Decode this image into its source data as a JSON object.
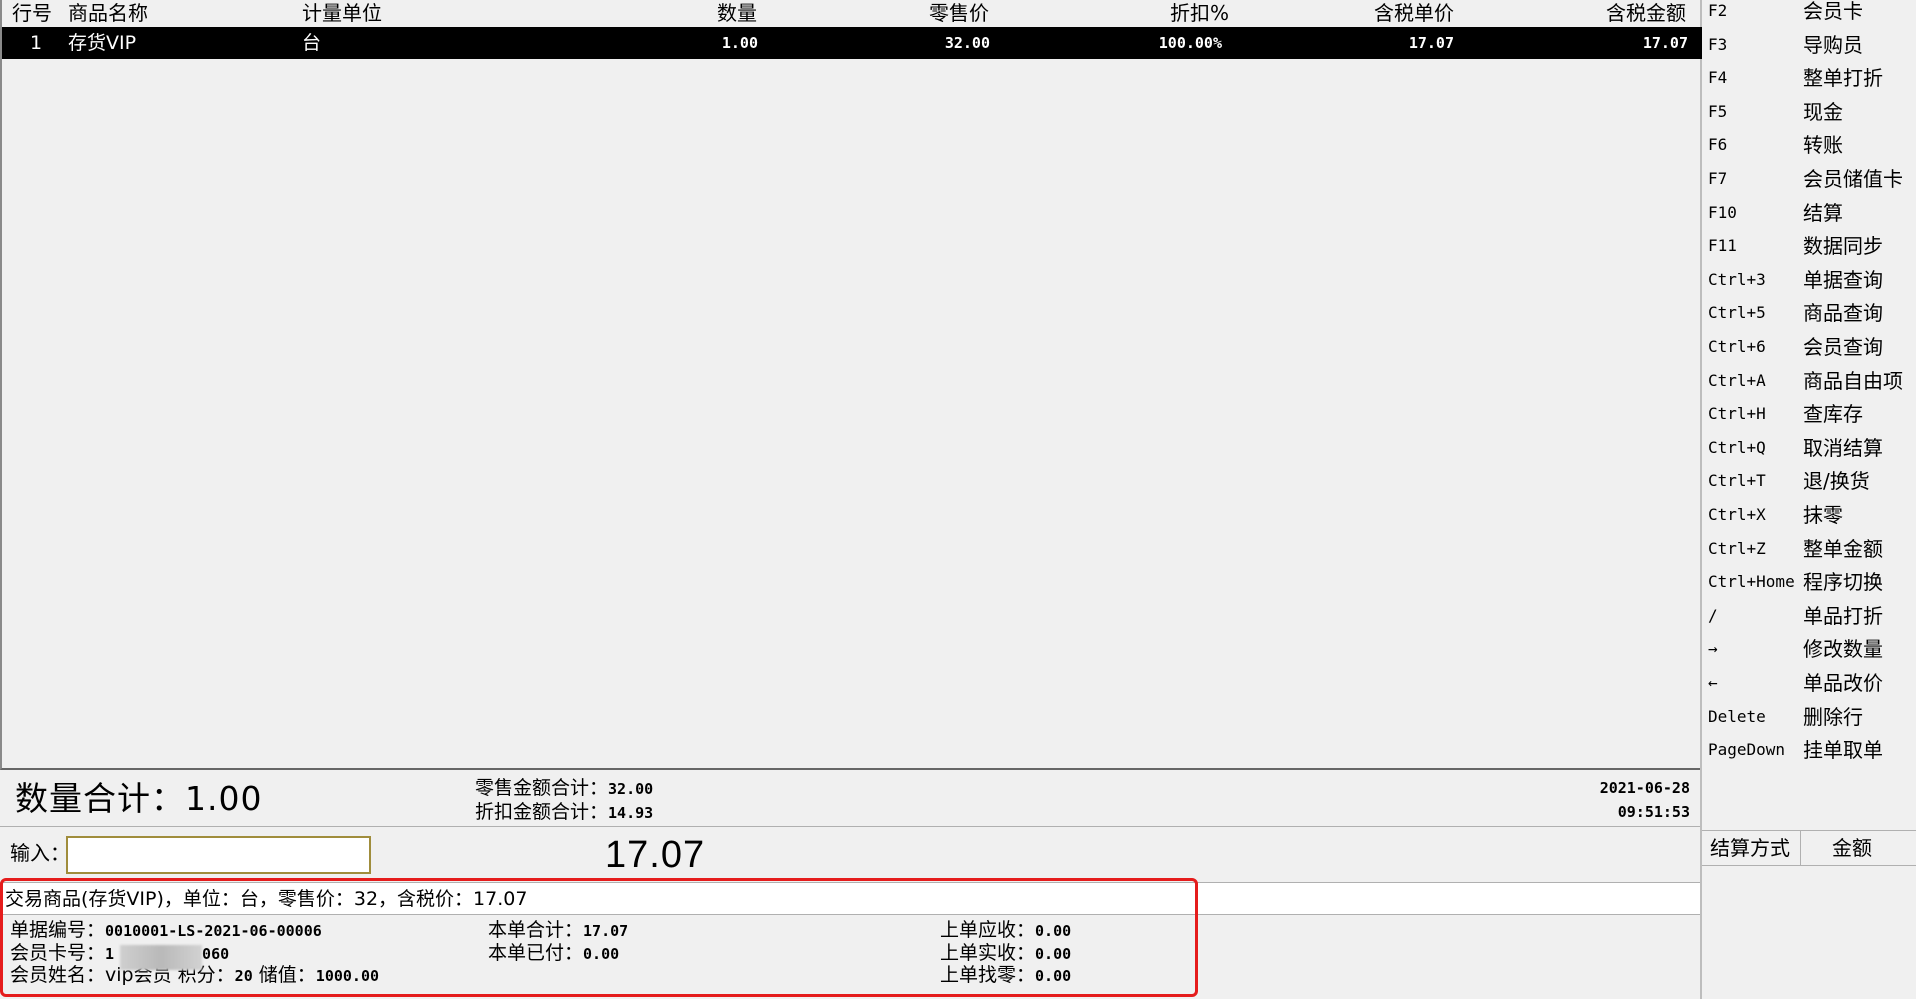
{
  "grid": {
    "headers": [
      "行号",
      "商品名称",
      "计量单位",
      "数量",
      "零售价",
      "折扣%",
      "含税单价",
      "含税金额"
    ],
    "row": {
      "line": "1",
      "name": "存货VIP",
      "unit": "台",
      "qty": "1.00",
      "retail": "32.00",
      "discount": "100.00%",
      "unit_price": "17.07",
      "amount": "17.07"
    }
  },
  "totals": {
    "qty_label": "数量合计：",
    "qty_value": "1.00",
    "retail_label": "零售金额合计：",
    "retail_value": "32.00",
    "discount_label": "折扣金额合计：",
    "discount_value": "14.93",
    "date": "2021-06-28",
    "time": "09:51:53"
  },
  "input": {
    "label": "输入：",
    "value": "",
    "big_amount": "17.07"
  },
  "info_line": "交易商品(存货VIP)，单位：台，零售价：32，含税价：17.07",
  "footer": {
    "doc_no_label": "单据编号：",
    "doc_no": "0010001-LS-2021-06-00006",
    "card_label": "会员卡号：",
    "card_start": "1",
    "card_end": "060",
    "member_name_label": "会员姓名：",
    "member_name": "vip会员",
    "points_label": "积分：",
    "points": "20",
    "stored_label": "储值：",
    "stored": "1000.00",
    "total_label": "本单合计：",
    "total": "17.07",
    "paid_label": "本单已付：",
    "paid": "0.00",
    "prev_due_label": "上单应收：",
    "prev_due": "0.00",
    "prev_recv_label": "上单实收：",
    "prev_recv": "0.00",
    "prev_change_label": "上单找零：",
    "prev_change": "0.00"
  },
  "shortcuts": [
    {
      "key": "F2",
      "action": "会员卡"
    },
    {
      "key": "F3",
      "action": "导购员"
    },
    {
      "key": "F4",
      "action": "整单打折"
    },
    {
      "key": "F5",
      "action": "现金"
    },
    {
      "key": "F6",
      "action": "转账"
    },
    {
      "key": "F7",
      "action": "会员储值卡"
    },
    {
      "key": "F10",
      "action": "结算"
    },
    {
      "key": "F11",
      "action": "数据同步"
    },
    {
      "key": "Ctrl+3",
      "action": "单据查询"
    },
    {
      "key": "Ctrl+5",
      "action": "商品查询"
    },
    {
      "key": "Ctrl+6",
      "action": "会员查询"
    },
    {
      "key": "Ctrl+A",
      "action": "商品自由项"
    },
    {
      "key": "Ctrl+H",
      "action": "查库存"
    },
    {
      "key": "Ctrl+Q",
      "action": "取消结算"
    },
    {
      "key": "Ctrl+T",
      "action": "退/换货"
    },
    {
      "key": "Ctrl+X",
      "action": "抹零"
    },
    {
      "key": "Ctrl+Z",
      "action": "整单金额"
    },
    {
      "key": "Ctrl+Home",
      "action": "程序切换"
    },
    {
      "key": "/",
      "action": "单品打折"
    },
    {
      "key": "→",
      "action": "修改数量"
    },
    {
      "key": "←",
      "action": "单品改价"
    },
    {
      "key": "Delete",
      "action": "删除行"
    },
    {
      "key": "PageDown",
      "action": "挂单取单"
    }
  ],
  "settlement": {
    "col_method": "结算方式",
    "col_amount": "金额"
  },
  "colors": {
    "highlight": "#e51c1c",
    "selected_row_bg": "#000000",
    "input_border": "#a08d3c"
  }
}
